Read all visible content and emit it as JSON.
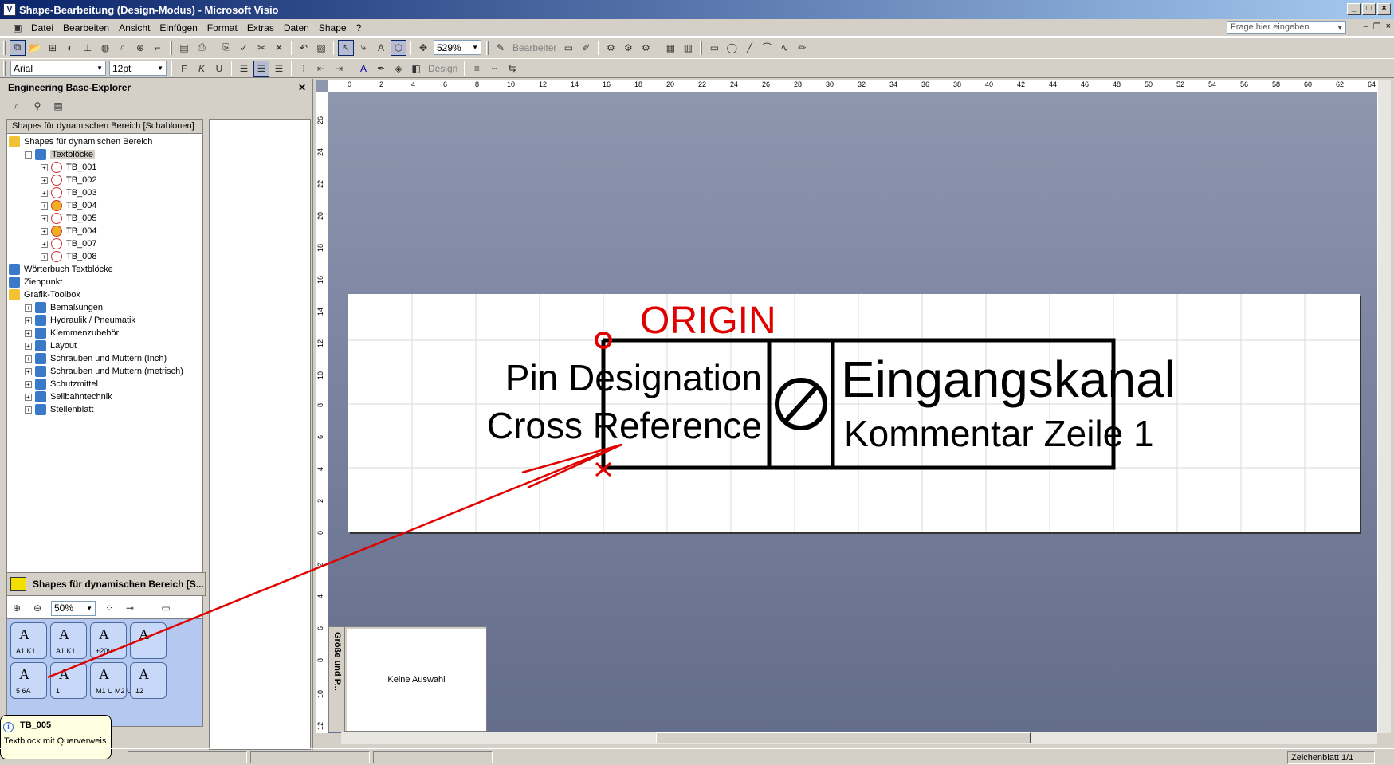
{
  "window": {
    "title": "Shape-Bearbeitung (Design-Modus) - Microsoft Visio"
  },
  "menu": [
    "Datei",
    "Bearbeiten",
    "Ansicht",
    "Einfügen",
    "Format",
    "Extras",
    "Daten",
    "Shape",
    "?"
  ],
  "help_search": {
    "placeholder": "Frage hier eingeben"
  },
  "toolbar1": {
    "zoom": "529%",
    "bearbeiter_label": "Bearbeiter"
  },
  "toolbar2": {
    "font": "Arial",
    "size": "12pt",
    "bold": "F",
    "italic": "K",
    "underline": "U",
    "design_label": "Design"
  },
  "explorer": {
    "title": "Engineering Base-Explorer",
    "tree_header": "Shapes für dynamischen Bereich [Schablonen]",
    "tree": [
      {
        "label": "Shapes für dynamischen Bereich",
        "icon": "folder-icon",
        "level": 0
      },
      {
        "label": "Textblöcke",
        "icon": "stencil-icon",
        "level": 1,
        "expander": "−",
        "selected": true
      },
      {
        "label": "TB_001",
        "icon": "textblock-icon",
        "level": 2,
        "expander": "+"
      },
      {
        "label": "TB_002",
        "icon": "textblock-icon",
        "level": 2,
        "expander": "+"
      },
      {
        "label": "TB_003",
        "icon": "textblock-icon",
        "level": 2,
        "expander": "+"
      },
      {
        "label": "TB_004",
        "icon": "textblock-warning-icon",
        "level": 2,
        "expander": "+"
      },
      {
        "label": "TB_005",
        "icon": "textblock-icon",
        "level": 2,
        "expander": "+"
      },
      {
        "label": "TB_004",
        "icon": "textblock-warning-icon",
        "level": 2,
        "expander": "+"
      },
      {
        "label": "TB_007",
        "icon": "textblock-icon",
        "level": 2,
        "expander": "+"
      },
      {
        "label": "TB_008",
        "icon": "textblock-icon",
        "level": 2,
        "expander": "+"
      },
      {
        "label": "Wörterbuch Textblöcke",
        "icon": "stencil-icon",
        "level": 0
      },
      {
        "label": "Ziehpunkt",
        "icon": "stencil-icon",
        "level": 0
      },
      {
        "label": "Grafik-Toolbox",
        "icon": "folder-icon",
        "level": 0
      },
      {
        "label": "Bemaßungen",
        "icon": "stencil-icon",
        "level": 1,
        "expander": "+"
      },
      {
        "label": "Hydraulik / Pneumatik",
        "icon": "stencil-icon",
        "level": 1,
        "expander": "+"
      },
      {
        "label": "Klemmenzubehör",
        "icon": "stencil-icon",
        "level": 1,
        "expander": "+"
      },
      {
        "label": "Layout",
        "icon": "stencil-icon",
        "level": 1,
        "expander": "+"
      },
      {
        "label": "Schrauben und Muttern (Inch)",
        "icon": "stencil-icon",
        "level": 1,
        "expander": "+"
      },
      {
        "label": "Schrauben und Muttern (metrisch)",
        "icon": "stencil-icon",
        "level": 1,
        "expander": "+"
      },
      {
        "label": "Schutzmittel",
        "icon": "stencil-icon",
        "level": 1,
        "expander": "+"
      },
      {
        "label": "Seilbahntechnik",
        "icon": "stencil-icon",
        "level": 1,
        "expander": "+"
      },
      {
        "label": "Stellenblatt",
        "icon": "stencil-icon",
        "level": 1,
        "expander": "+"
      }
    ]
  },
  "stencil": {
    "title": "Shapes für dynamischen Bereich [S...",
    "zoom": "50%",
    "masters": [
      {
        "label": "A1 K1"
      },
      {
        "label": "A1 K1"
      },
      {
        "label": "+20V"
      },
      {
        "label": ""
      },
      {
        "label": "5 6A"
      },
      {
        "label": "1"
      },
      {
        "label": "M1 U M2 U"
      },
      {
        "label": "12"
      }
    ]
  },
  "tooltip": {
    "title": "TB_005",
    "description": "Textblock mit Querverweis"
  },
  "drawing": {
    "origin_label": "ORIGIN",
    "pin_designation": "Pin Designation",
    "cross_reference": "Cross Reference",
    "channel": "Eingangskanal",
    "comment": "Kommentar Zeile 1",
    "symbol": "⊘",
    "accent_color": "#e00000"
  },
  "size_panel": {
    "title": "Größe und P...",
    "body": "Keine Auswahl"
  },
  "status": {
    "page": "Zeichenblatt 1/1"
  },
  "ruler_h": [
    "0",
    "2",
    "4",
    "6",
    "8",
    "10",
    "12",
    "14",
    "16",
    "18",
    "20",
    "22",
    "24",
    "26",
    "28",
    "30",
    "32",
    "34",
    "36",
    "38",
    "40",
    "42",
    "44",
    "46",
    "48",
    "50",
    "52",
    "54",
    "56",
    "58",
    "60",
    "62",
    "64"
  ],
  "ruler_v": [
    "26",
    "24",
    "22",
    "20",
    "18",
    "16",
    "14",
    "12",
    "10",
    "8",
    "6",
    "4",
    "2",
    "0",
    "2",
    "4",
    "6",
    "8",
    "10",
    "12"
  ]
}
